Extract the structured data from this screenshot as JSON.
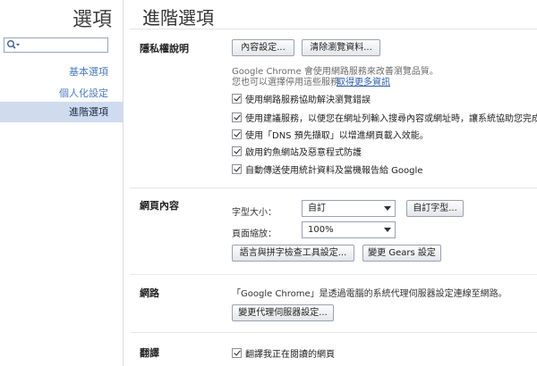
{
  "sidebar": {
    "title": "選項",
    "search_placeholder": "",
    "items": [
      {
        "label": "基本選項"
      },
      {
        "label": "個人化設定"
      },
      {
        "label": "進階選項"
      }
    ]
  },
  "main": {
    "title": "進階選項",
    "privacy": {
      "label": "隱私權說明",
      "content_settings": "內容設定...",
      "clear_browsing": "清除瀏覽資料...",
      "desc1": "Google Chrome 會使用網路服務來改善瀏覽品質。",
      "desc2": "您也可以選擇停用這些服務",
      "learn_more": "取得更多資訊",
      "options": [
        {
          "label": "使用網路服務協助解決瀏覽錯誤",
          "checked": true
        },
        {
          "label": "使用建議服務，以便您在網址列輸入搜尋內容或網址時，讓系統協助您完成",
          "checked": true
        },
        {
          "label": "使用「DNS 預先擷取」以增進網頁載入效能。",
          "checked": true
        },
        {
          "label": "啟用釣魚網站及惡意程式防護",
          "checked": true
        },
        {
          "label": "自動傳送使用統計資料及當機報告給 Google",
          "checked": true
        }
      ]
    },
    "web_content": {
      "label": "網頁內容",
      "font_size_label": "字型大小：",
      "font_size_value": "自訂",
      "custom_fonts": "自訂字型...",
      "zoom_label": "頁面縮放：",
      "zoom_value": "100%",
      "lang_settings": "語言與拼字檢查工具設定...",
      "gears_settings": "變更 Gears 設定"
    },
    "network": {
      "label": "網路",
      "desc": "「Google Chrome」是透過電腦的系統代理伺服器設定連線至網路。",
      "proxy_button": "變更代理伺服器設定..."
    },
    "translate": {
      "label": "翻譯",
      "option": "翻譯我正在閱讀的網頁",
      "checked": true
    }
  }
}
